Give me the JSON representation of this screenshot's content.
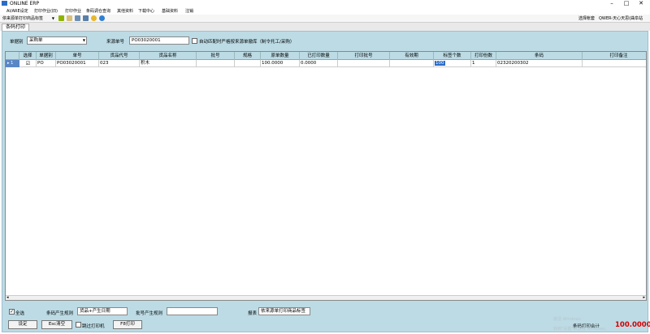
{
  "window": {
    "title": "ONLINE ERP",
    "controls": {
      "minimize": "–",
      "maximize": "□",
      "close": "✕"
    }
  },
  "menu": [
    "AI/ARE设定",
    "打印作业(旧)",
    "打印作业",
    "条码调仓查询",
    "其他资料",
    "下载中心",
    "基础资料",
    "注销"
  ],
  "toolbar": {
    "combo": "依来源单打印商品标签",
    "right_label": "选择帐套",
    "user": "QWER-天心天思(曲阜站"
  },
  "tab": {
    "label": "条码打印"
  },
  "filters": {
    "doc_type_label": "单据别",
    "doc_type_value": "采购单",
    "source_no_label": "来源单号",
    "source_no_value": "PO03020001",
    "auto_match_label": "自动匹配时严格按来源单撤库（制令托工/采购）"
  },
  "grid": {
    "columns": [
      "选择",
      "单据别",
      "单号",
      "货品代号",
      "货品名称",
      "批号",
      "规格",
      "原单数量",
      "已打印数量",
      "打印批号",
      "有效期",
      "标签个数",
      "打印份数",
      "条码",
      "打印备注"
    ],
    "rows": [
      {
        "indicator": "▸ 1",
        "selected": "☑",
        "doc_type": "PO",
        "doc_no": "PO03020001",
        "item_code": "023",
        "item_name": "积木",
        "batch": "",
        "spec": "",
        "orig_qty": "100.0000",
        "printed_qty": "0.0000",
        "print_batch": "",
        "expiry": "",
        "label_count": "100",
        "print_copies": "1",
        "barcode": "02320200302",
        "print_note": ""
      }
    ]
  },
  "bottom": {
    "select_all_label": "全选",
    "barcode_rule_label": "条码产生规则",
    "barcode_rule_value": "货品+产生日期",
    "batch_rule_label": "批号产生规则",
    "batch_rule_value": "",
    "report_label": "报表",
    "report_value": "依来源单打印商品标签",
    "settings_btn": "设定",
    "clear_btn": "Esc清空",
    "skip_printer_label": "跳过打印机",
    "print_btn": "F8打印",
    "total_label": "条码打印合计",
    "total_value": "100.0000"
  },
  "watermark": {
    "line1": "激活 Windows",
    "line2": "转到\"设置\"以激活 Windows。"
  }
}
